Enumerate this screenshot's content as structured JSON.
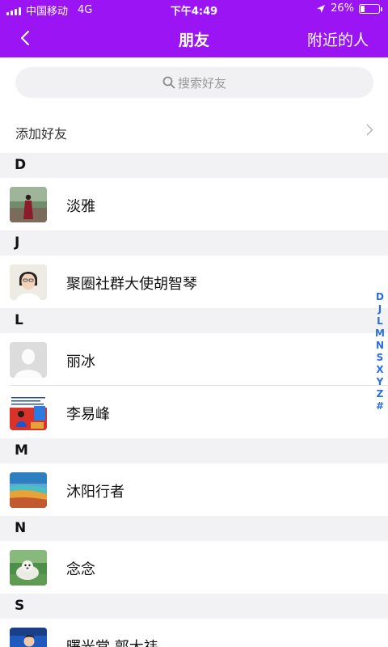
{
  "status_bar": {
    "carrier": "中国移动",
    "network": "4G",
    "time": "下午4:49",
    "battery_percent": "26%",
    "battery_level": 0.26
  },
  "nav": {
    "title": "朋友",
    "right_label": "附近的人",
    "back_icon": "chevron-left-icon"
  },
  "search": {
    "placeholder": "搜索好友",
    "icon": "search-icon"
  },
  "add_friend": {
    "label": "添加好友",
    "icon": "chevron-right-icon"
  },
  "sections": [
    {
      "letter": "D",
      "contacts": [
        {
          "name": "淡雅",
          "avatar": "person-standing-photo"
        }
      ]
    },
    {
      "letter": "J",
      "contacts": [
        {
          "name": "聚圈社群大使胡智琴",
          "avatar": "portrait-photo"
        }
      ]
    },
    {
      "letter": "L",
      "contacts": [
        {
          "name": "丽冰",
          "avatar": "default-avatar-icon"
        },
        {
          "name": "李易峰",
          "avatar": "poster-photo"
        }
      ]
    },
    {
      "letter": "M",
      "contacts": [
        {
          "name": "沐阳行者",
          "avatar": "landscape-photo"
        }
      ]
    },
    {
      "letter": "N",
      "contacts": [
        {
          "name": "念念",
          "avatar": "seal-photo"
        }
      ]
    },
    {
      "letter": "S",
      "contacts": [
        {
          "name": "曙光堂 郭大祎",
          "avatar": "speaker-photo"
        }
      ]
    }
  ],
  "index_letters": [
    "D",
    "J",
    "L",
    "M",
    "N",
    "S",
    "X",
    "Y",
    "Z",
    "#"
  ],
  "colors": {
    "accent": "#9a14f4",
    "index": "#2a6ee0",
    "section_bg": "#f2f2f4"
  }
}
